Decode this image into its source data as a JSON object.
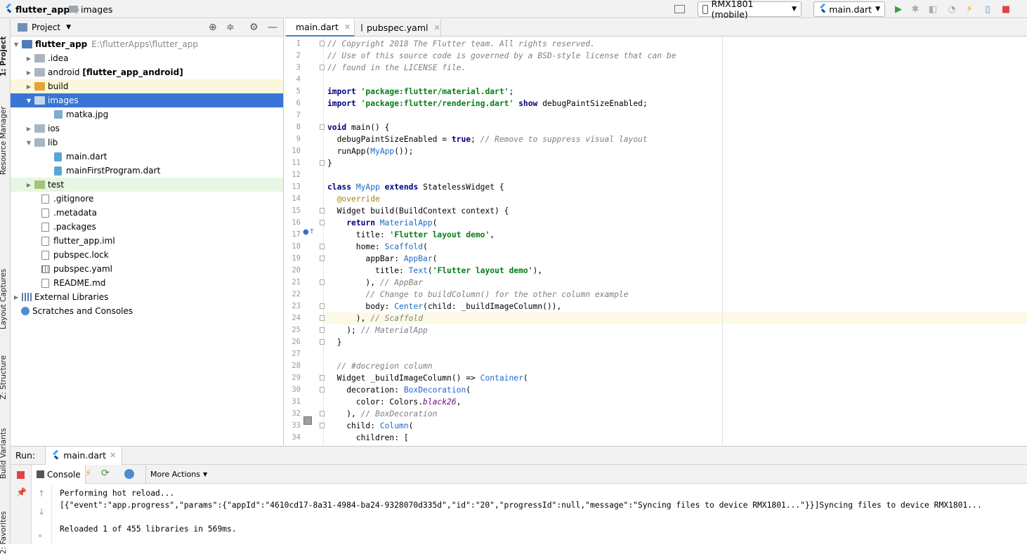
{
  "breadcrumb": {
    "project": "flutter_app",
    "folder": "images"
  },
  "toolbar": {
    "device": "RMX1801 (mobile)",
    "config": "main.dart"
  },
  "sidestrip": {
    "project": "1: Project",
    "resource": "Resource Manager",
    "layout": "Layout Captures",
    "structure": "Z: Structure",
    "variants": "Build Variants",
    "favorites": "2: Favorites"
  },
  "project_panel": {
    "title": "Project",
    "root": {
      "name": "flutter_app",
      "path": "E:\\flutterApps\\flutter_app"
    },
    "items": [
      {
        "label": ".idea"
      },
      {
        "label": "android",
        "suffix": "[flutter_app_android]"
      },
      {
        "label": "build"
      },
      {
        "label": "images"
      },
      {
        "label": "matka.jpg"
      },
      {
        "label": "ios"
      },
      {
        "label": "lib"
      },
      {
        "label": "main.dart"
      },
      {
        "label": "mainFirstProgram.dart"
      },
      {
        "label": "test"
      },
      {
        "label": ".gitignore"
      },
      {
        "label": ".metadata"
      },
      {
        "label": ".packages"
      },
      {
        "label": "flutter_app.iml"
      },
      {
        "label": "pubspec.lock"
      },
      {
        "label": "pubspec.yaml"
      },
      {
        "label": "README.md"
      },
      {
        "label": "External Libraries"
      },
      {
        "label": "Scratches and Consoles"
      }
    ]
  },
  "editor": {
    "tabs": [
      {
        "label": "main.dart"
      },
      {
        "label": "pubspec.yaml"
      }
    ],
    "lines": [
      "// Copyright 2018 The Flutter team. All rights reserved.",
      "// Use of this source code is governed by a BSD-style license that can be",
      "// found in the LICENSE file.",
      "",
      "import 'package:flutter/material.dart';",
      "import 'package:flutter/rendering.dart' show debugPaintSizeEnabled;",
      "",
      "void main() {",
      "  debugPaintSizeEnabled = true; // Remove to suppress visual layout",
      "  runApp(MyApp());",
      "}",
      "",
      "class MyApp extends StatelessWidget {",
      "  @override",
      "  Widget build(BuildContext context) {",
      "    return MaterialApp(",
      "      title: 'Flutter layout demo',",
      "      home: Scaffold(",
      "        appBar: AppBar(",
      "          title: Text('Flutter layout demo'),",
      "        ), // AppBar",
      "        // Change to buildColumn() for the other column example",
      "        body: Center(child: _buildImageColumn()),",
      "      ), // Scaffold",
      "    ); // MaterialApp",
      "  }",
      "",
      "  // #docregion column",
      "  Widget _buildImageColumn() => Container(",
      "    decoration: BoxDecoration(",
      "      color: Colors.black26,",
      "    ), // BoxDecoration",
      "    child: Column(",
      "      children: ["
    ]
  },
  "run_panel": {
    "label": "Run:",
    "tab": "main.dart",
    "console_tab": "Console",
    "more_actions": "More Actions",
    "output": [
      "Performing hot reload...",
      "[{\"event\":\"app.progress\",\"params\":{\"appId\":\"4610cd17-8a31-4984-ba24-9328070d335d\",\"id\":\"20\",\"progressId\":null,\"message\":\"Syncing files to device RMX1801...\"}}]Syncing files to device RMX1801...",
      "",
      "Reloaded 1 of 455 libraries in 569ms."
    ]
  }
}
